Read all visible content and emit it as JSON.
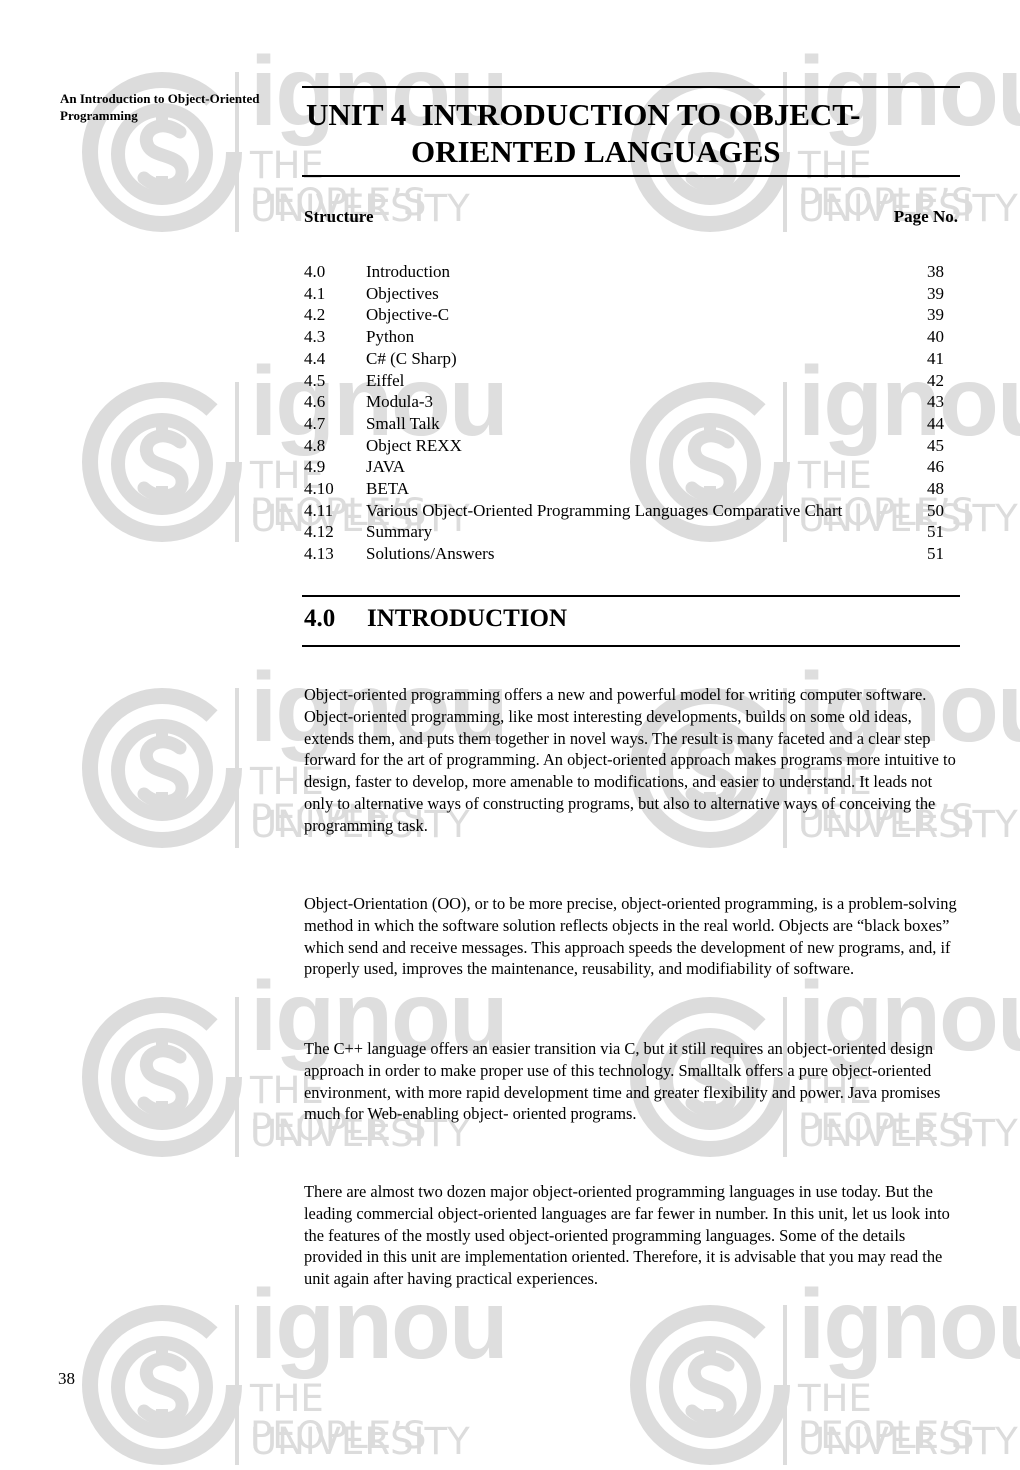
{
  "watermark": {
    "word": "ignou",
    "tagline_line1": "THE PEOPLE’S",
    "tagline_line2": "UNIVERSITY",
    "color": "#dcdcdc"
  },
  "running_head": "An Introduction to Object-Oriented Programming",
  "unit_title": {
    "line1": "UNIT 4  INTRODUCTION TO OBJECT-",
    "line2": "ORIENTED LANGUAGES"
  },
  "structure": {
    "label": "Structure",
    "page_label": "Page No.",
    "items": [
      {
        "num": "4.0",
        "title": "Introduction",
        "page": "38"
      },
      {
        "num": "4.1",
        "title": "Objectives",
        "page": "39"
      },
      {
        "num": "4.2",
        "title": "Objective-C",
        "page": "39"
      },
      {
        "num": "4.3",
        "title": "Python",
        "page": "40"
      },
      {
        "num": "4.4",
        "title": "C# (C Sharp)",
        "page": "41"
      },
      {
        "num": "4.5",
        "title": "Eiffel",
        "page": "42"
      },
      {
        "num": "4.6",
        "title": "Modula-3",
        "page": "43"
      },
      {
        "num": "4.7",
        "title": "Small Talk",
        "page": "44"
      },
      {
        "num": "4.8",
        "title": "Object REXX",
        "page": "45"
      },
      {
        "num": "4.9",
        "title": "JAVA",
        "page": "46"
      },
      {
        "num": "4.10",
        "title": "BETA",
        "page": "48"
      },
      {
        "num": "4.11",
        "title": "Various Object-Oriented Programming Languages Comparative Chart",
        "page": "50"
      },
      {
        "num": "4.12",
        "title": "Summary",
        "page": "51"
      },
      {
        "num": "4.13",
        "title": "Solutions/Answers",
        "page": "51"
      }
    ]
  },
  "section": {
    "number": "4.0",
    "title": "INTRODUCTION",
    "paragraphs": [
      "Object-oriented programming offers a new and powerful model for writing computer software.  Object-oriented programming, like most interesting developments, builds on some old ideas, extends them, and puts them together in novel ways. The result is many faceted and a clear step forward for the art of programming. An object-oriented approach makes programs more intuitive to design, faster to develop, more amenable to modifications, and easier to understand. It leads not only to alternative ways of constructing programs, but also to alternative ways of conceiving the programming task.",
      "Object-Orientation (OO), or to be more precise, object-oriented programming, is a problem-solving method in which the software solution reflects objects in the real world.  Objects are “black boxes” which send and receive messages.  This approach speeds the development of new programs, and, if properly used, improves the maintenance, reusability, and modifiability of software.",
      "The C++ language offers an easier transition via C, but it still requires an object-oriented design approach in order to make proper use of this technology.  Smalltalk offers a pure object-oriented environment, with more rapid development time and greater flexibility and power.  Java promises much for Web-enabling object- oriented programs.",
      "There are almost two dozen major object-oriented programming languages in use today.  But the leading commercial object-oriented languages are far fewer in number.  In this unit, let us look into the features of the mostly used object-oriented programming languages.  Some of the details provided in this unit are implementation oriented. Therefore, it is advisable that you may read the unit again after having practical experiences."
    ]
  },
  "page_number": "38"
}
